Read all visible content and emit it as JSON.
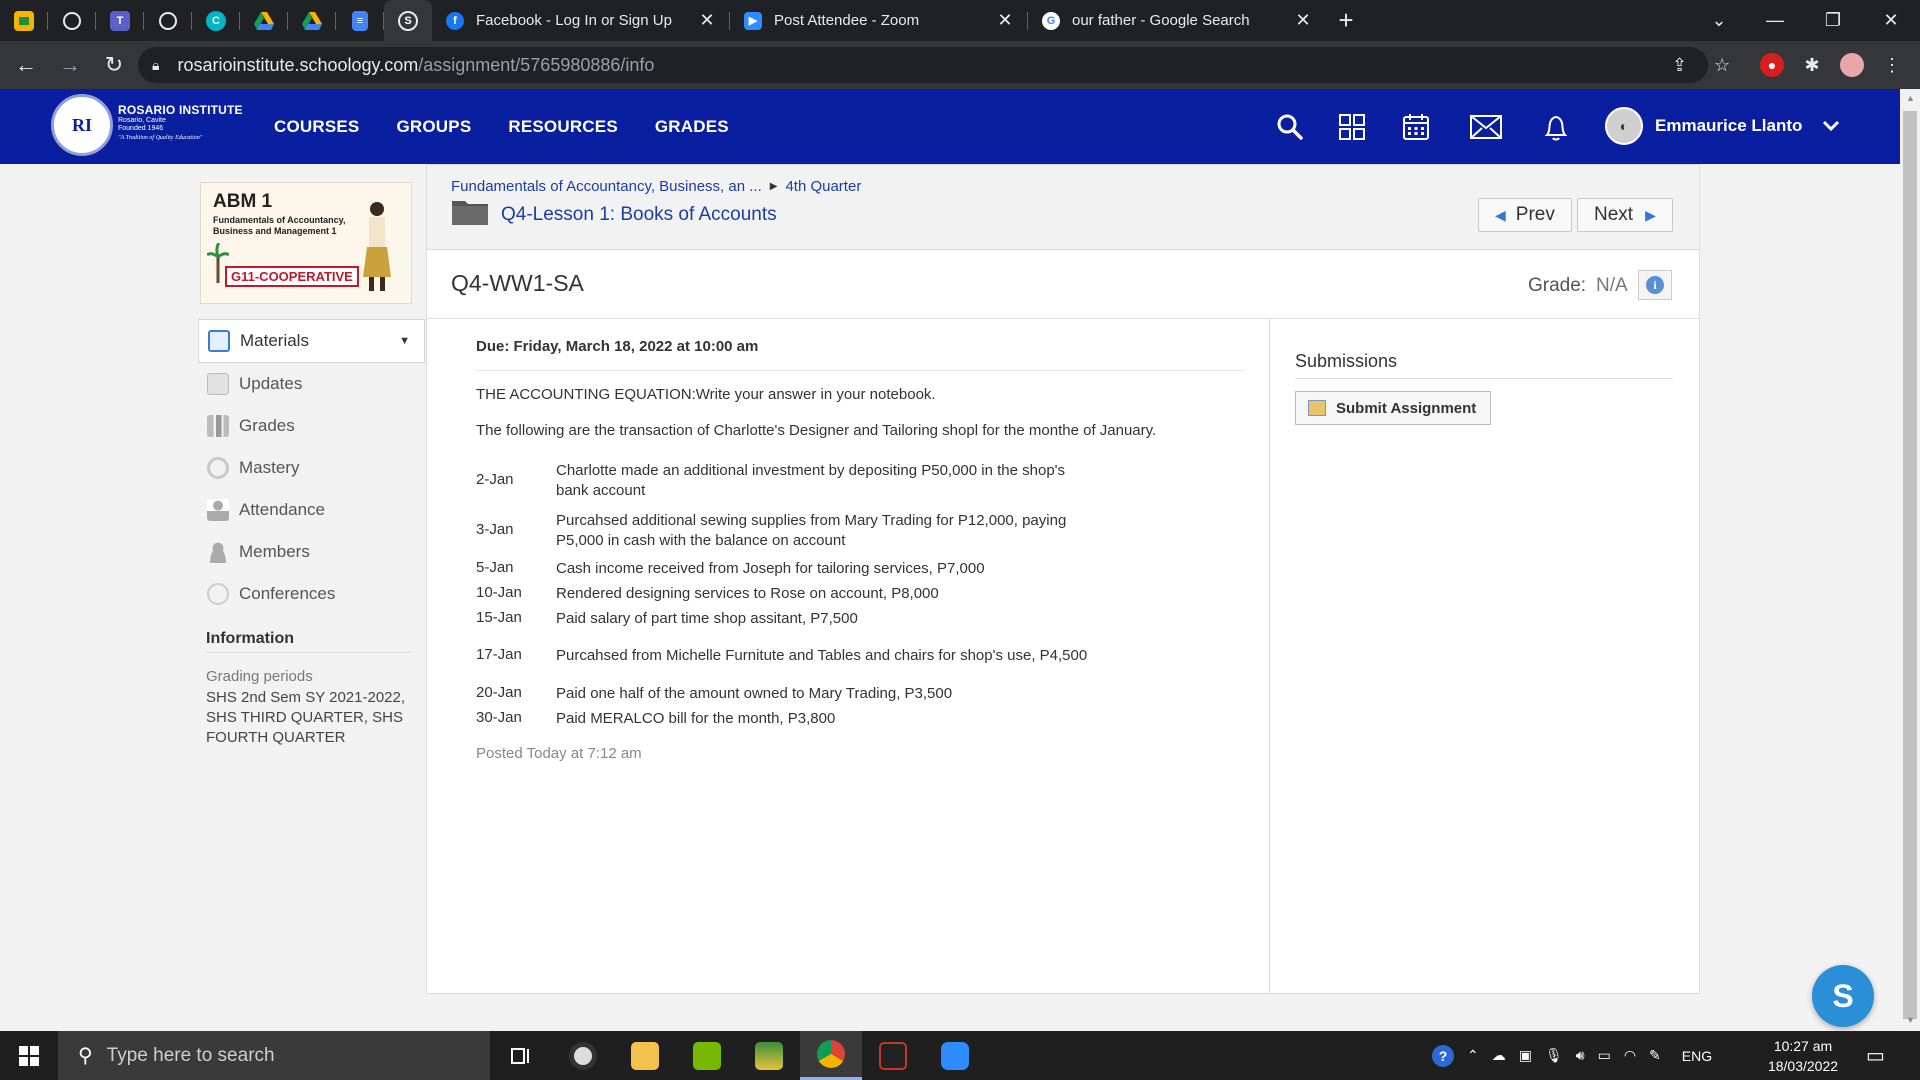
{
  "browser": {
    "tabs": [
      {
        "title": "Facebook - Log In or Sign Up",
        "icon": "facebook-icon"
      },
      {
        "title": "Post Attendee - Zoom",
        "icon": "zoom-icon"
      },
      {
        "title": "our father - Google Search",
        "icon": "google-icon"
      }
    ],
    "url_host": "rosarioinstitute.schoology.com",
    "url_path": "/assignment/5765980886/info"
  },
  "header": {
    "school_name": "ROSARIO INSTITUTE",
    "school_location": "Rosario, Cavite",
    "school_founded": "Founded 1946",
    "school_motto": "\"A Tradition of Quality Education\"",
    "nav": [
      "COURSES",
      "GROUPS",
      "RESOURCES",
      "GRADES"
    ],
    "user_name": "Emmaurice Llanto"
  },
  "course": {
    "code": "ABM 1",
    "subtitle": "Fundamentals of Accountancy, Business and Management 1",
    "section": "G11-COOPERATIVE"
  },
  "sidebar": {
    "items": [
      {
        "label": "Materials",
        "icon": "materials-icon"
      },
      {
        "label": "Updates",
        "icon": "updates-icon"
      },
      {
        "label": "Grades",
        "icon": "grades-icon"
      },
      {
        "label": "Mastery",
        "icon": "mastery-icon"
      },
      {
        "label": "Attendance",
        "icon": "attendance-icon"
      },
      {
        "label": "Members",
        "icon": "members-icon"
      },
      {
        "label": "Conferences",
        "icon": "conferences-icon"
      }
    ],
    "info_heading": "Information",
    "grading_label": "Grading periods",
    "grading_value": "SHS 2nd Sem SY 2021-2022, SHS THIRD QUARTER, SHS FOURTH QUARTER"
  },
  "breadcrumb": {
    "course": "Fundamentals of Accountancy, Business, an ...",
    "folder": "4th Quarter",
    "lesson": "Q4-Lesson 1: Books of Accounts"
  },
  "pager": {
    "prev": "Prev",
    "next": "Next"
  },
  "assignment": {
    "title": "Q4-WW1-SA",
    "grade_label": "Grade:",
    "grade_value": "N/A",
    "due": "Due: Friday, March 18, 2022 at 10:00 am",
    "intro1": "THE ACCOUNTING EQUATION:Write your answer in your notebook.",
    "intro2": "The following are the  transaction of Charlotte's Designer and Tailoring shopl for the monthe of January.",
    "transactions": [
      {
        "date": "2-Jan",
        "text": "Charlotte made an additional investment by depositing P50,000 in the shop's bank account"
      },
      {
        "date": "3-Jan",
        "text": "Purcahsed additional sewing supplies from Mary Trading for P12,000, paying P5,000 in cash with the balance on account"
      },
      {
        "date": "5-Jan",
        "text": "Cash income received from Joseph for tailoring services, P7,000"
      },
      {
        "date": "10-Jan",
        "text": "Rendered designing services to Rose on account, P8,000"
      },
      {
        "date": "15-Jan",
        "text": "Paid salary of part time shop assitant, P7,500"
      },
      {
        "date": "17-Jan",
        "text": "Purcahsed from Michelle Furnitute and Tables and chairs for shop's use, P4,500"
      },
      {
        "date": "20-Jan",
        "text": "Paid one half of the amount owned to Mary Trading, P3,500"
      },
      {
        "date": "30-Jan",
        "text": "Paid MERALCO bill for the month, P3,800"
      }
    ],
    "posted": "Posted Today at 7:12 am"
  },
  "submissions": {
    "heading": "Submissions",
    "button": "Submit Assignment"
  },
  "help_fab": "S",
  "taskbar": {
    "search_placeholder": "Type here to search",
    "lang": "ENG",
    "time": "10:27 am",
    "date": "18/03/2022"
  },
  "colors": {
    "header_bg": "#0a1ea0",
    "link": "#1a3ea8",
    "fab": "#2a8fd6"
  }
}
